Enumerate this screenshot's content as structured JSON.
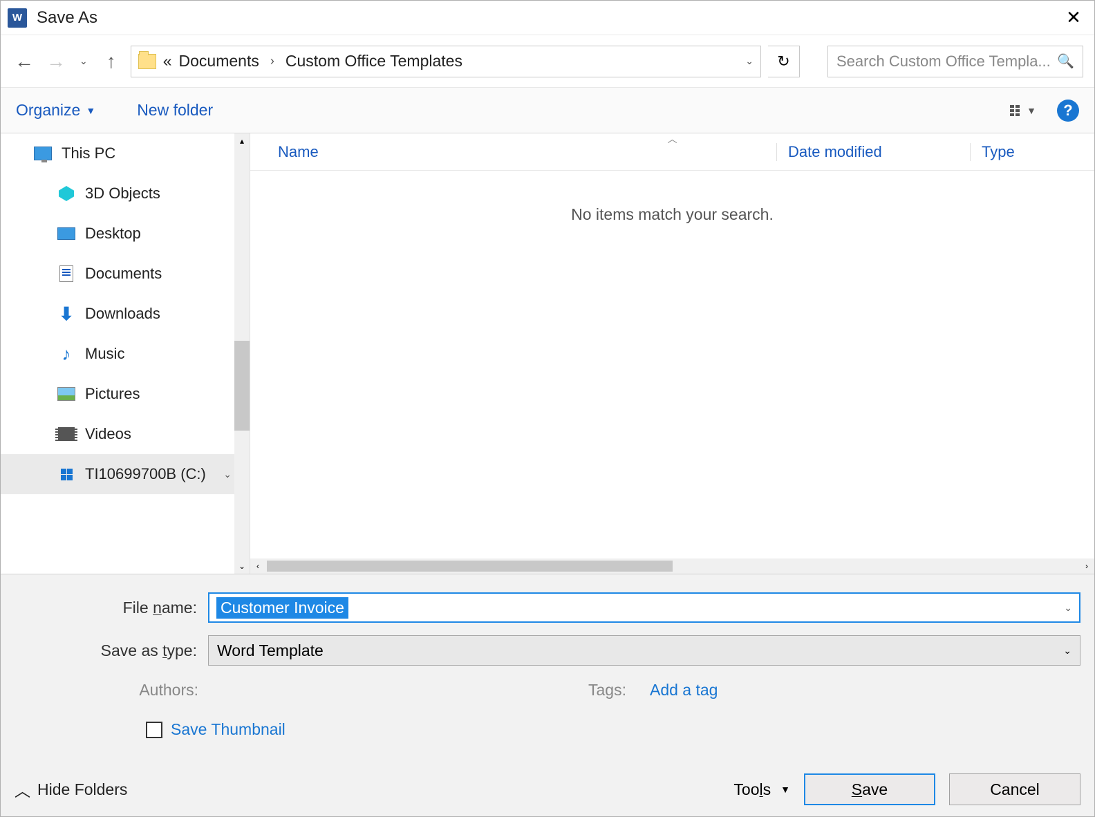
{
  "title": "Save As",
  "breadcrumb": {
    "overflow": "«",
    "seg1": "Documents",
    "seg2": "Custom Office Templates"
  },
  "search": {
    "placeholder": "Search Custom Office Templa..."
  },
  "toolbar": {
    "organize": "Organize",
    "newfolder": "New folder"
  },
  "columns": {
    "name": "Name",
    "date": "Date modified",
    "type": "Type"
  },
  "empty_message": "No items match your search.",
  "sidebar": {
    "root": "This PC",
    "items": [
      "3D Objects",
      "Desktop",
      "Documents",
      "Downloads",
      "Music",
      "Pictures",
      "Videos",
      "TI10699700B (C:)"
    ]
  },
  "form": {
    "filename_label": "File name:",
    "filename_value": "Customer Invoice",
    "type_label": "Save as type:",
    "type_value": "Word Template",
    "authors_label": "Authors:",
    "tags_label": "Tags:",
    "add_tag": "Add a tag",
    "save_thumbnail": "Save Thumbnail"
  },
  "footer": {
    "hide_folders": "Hide Folders",
    "tools": "Tools",
    "save": "Save",
    "cancel": "Cancel"
  }
}
